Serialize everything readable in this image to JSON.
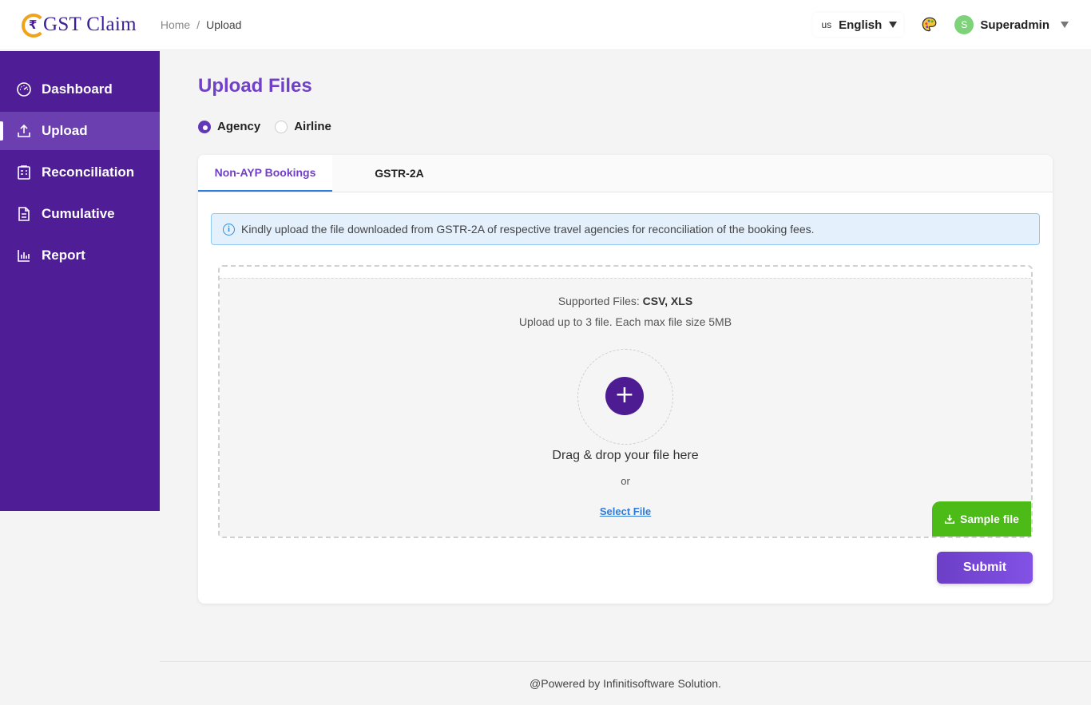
{
  "app": {
    "logo_text": "GST Claim"
  },
  "breadcrumb": {
    "home": "Home",
    "separator": "/",
    "current": "Upload"
  },
  "header": {
    "language": {
      "flag": "us",
      "label": "English"
    },
    "palette_icon": "palette-icon",
    "user": {
      "initial": "S",
      "name": "Superadmin"
    }
  },
  "sidebar": {
    "items": [
      {
        "label": "Dashboard",
        "icon": "dashboard-icon"
      },
      {
        "label": "Upload",
        "icon": "upload-icon",
        "active": true
      },
      {
        "label": "Reconciliation",
        "icon": "reconciliation-icon"
      },
      {
        "label": "Cumulative",
        "icon": "document-icon"
      },
      {
        "label": "Report",
        "icon": "bar-chart-icon"
      }
    ]
  },
  "main": {
    "title": "Upload Files",
    "radios": [
      {
        "label": "Agency",
        "checked": true
      },
      {
        "label": "Airline",
        "checked": false
      }
    ],
    "tabs": [
      {
        "label": "Non-AYP Bookings",
        "active": true
      },
      {
        "label": "GSTR-2A",
        "active": false
      }
    ],
    "info_text": "Kindly upload the file downloaded from GSTR-2A of respective travel agencies for reconciliation of the booking fees.",
    "dropzone": {
      "supported_prefix": "Supported Files:",
      "supported_types": "CSV, XLS",
      "limit_text": "Upload up to 3 file. Each max file size 5MB",
      "plus_symbol": "+",
      "drag_text": "Drag & drop your file here",
      "or_text": "or",
      "select_label": "Select File",
      "sample_label": "Sample file"
    },
    "submit_label": "Submit"
  },
  "footer": {
    "text": "@Powered by Infinitisoftware Solution."
  },
  "colors": {
    "sidebar": "#4f1d96",
    "accent": "#7040c6",
    "sample": "#4cbb17",
    "link": "#2f7bd8"
  }
}
